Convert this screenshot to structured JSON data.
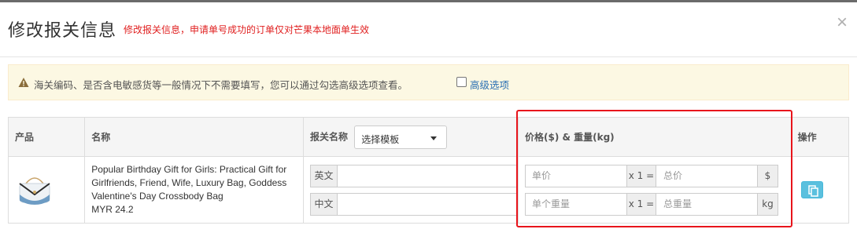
{
  "modal": {
    "title": "修改报关信息",
    "subtitle": "修改报关信息，申请单号成功的订单仅对芒果本地面单生效",
    "close_label": "×"
  },
  "alert": {
    "message": "海关编码、是否含电敏感货等一般情况下不需要填写，您可以通过勾选高级选项查看。",
    "advanced_label": "高级选项",
    "advanced_checked": false
  },
  "table": {
    "headers": {
      "product": "产品",
      "name": "名称",
      "declare_name": "报关名称",
      "price_weight": "价格($) & 重量(kg)",
      "action": "操作"
    },
    "template_select": {
      "selected": "选择模板"
    },
    "rows": [
      {
        "product_name": "Popular Birthday Gift for Girls: Practical Gift for Girlfriends, Friend, Wife, Luxury Bag, Goddess Valentine's Day Crossbody Bag",
        "price": "MYR 24.2",
        "english_label": "英文",
        "english_value": "",
        "chinese_label": "中文",
        "chinese_value": "",
        "unit_price_placeholder": "单价",
        "multiplier": "x 1 =",
        "total_price_placeholder": "总价",
        "currency_unit": "$",
        "unit_weight_placeholder": "单个重量",
        "total_weight_placeholder": "总重量",
        "weight_unit": "kg"
      }
    ]
  },
  "colors": {
    "title_text": "#333333",
    "subtitle_text": "#e02020",
    "alert_background": "#fcf8e3",
    "link": "#2a6fb3",
    "copy_button": "#5bc0de",
    "highlight_box": "#e8141b",
    "header_background": "#f5f5f5"
  },
  "icons": {
    "close": "close-icon",
    "alert": "warning-icon",
    "dropdown": "caret-down-icon",
    "copy": "copy-icon"
  }
}
